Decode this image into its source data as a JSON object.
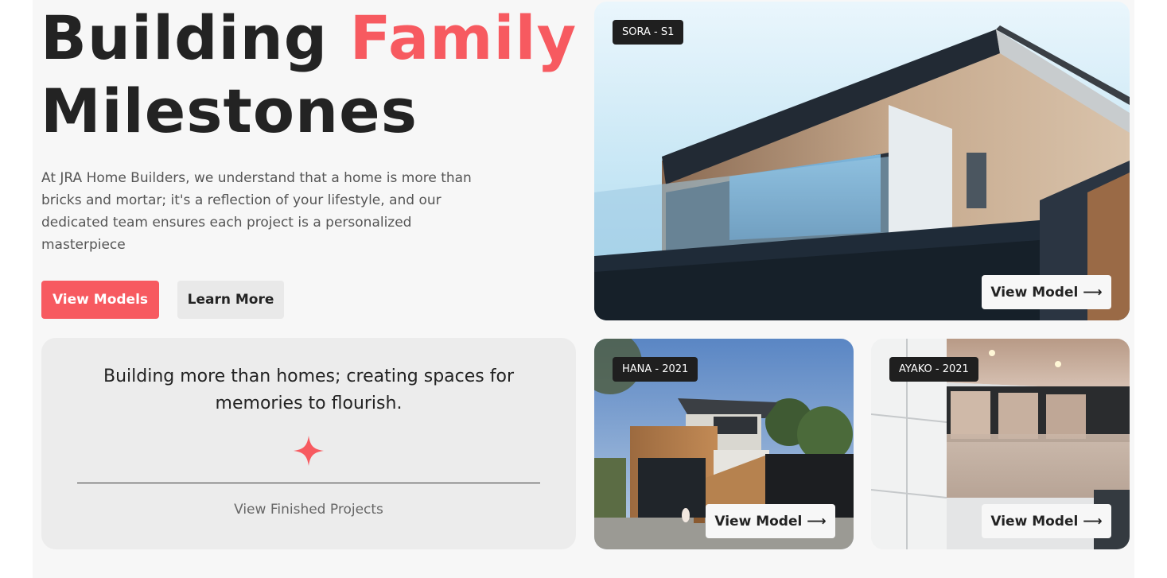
{
  "hero": {
    "title_part1": "Building ",
    "title_accent": "Family",
    "title_part2": "Milestones",
    "description": "At JRA Home Builders, we understand that a home is more than bricks and mortar; it's a reflection of your lifestyle, and our dedicated team ensures each project is a personalized masterpiece",
    "primary_button": "View Models",
    "secondary_button": "Learn More"
  },
  "quote": {
    "text": "Building more than homes; creating spaces for memories to flourish.",
    "link": "View Finished Projects",
    "icon": "sparkle-icon"
  },
  "models": [
    {
      "badge": "SORA - S1",
      "button": "View Model ⟶"
    },
    {
      "badge": "HANA - 2021",
      "button": "View Model ⟶"
    },
    {
      "badge": "AYAKO - 2021",
      "button": "View Model ⟶"
    }
  ],
  "colors": {
    "accent": "#f75a60",
    "text_dark": "#232323",
    "page_bg": "#f7f7f7",
    "card_bg": "#ececec",
    "badge_bg": "#1f1f1f"
  }
}
